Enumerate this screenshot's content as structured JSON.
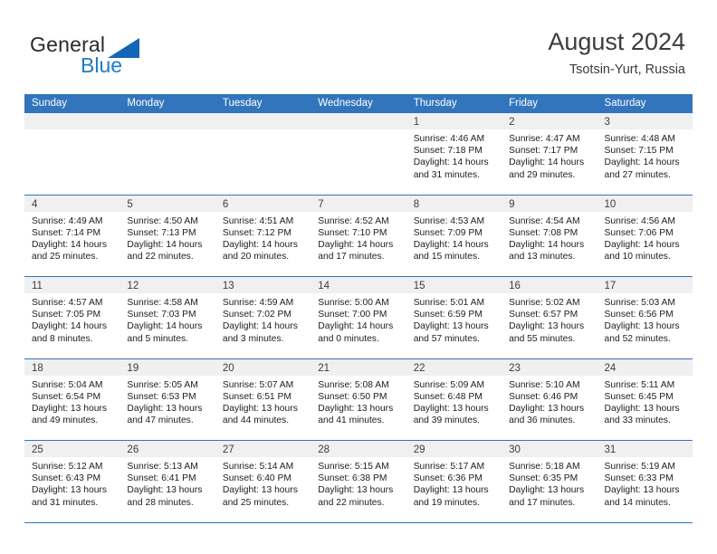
{
  "brand": {
    "name_top": "General",
    "name_bottom": "Blue",
    "triangle_color": "#1565b5",
    "blue_color": "#1f7cc4"
  },
  "header": {
    "title": "August 2024",
    "subtitle": "Tsotsin-Yurt, Russia"
  },
  "theme": {
    "header_blue": "#3275bd",
    "date_band": "#f0f0f0",
    "text": "#202020"
  },
  "calendar": {
    "weekdays": [
      "Sunday",
      "Monday",
      "Tuesday",
      "Wednesday",
      "Thursday",
      "Friday",
      "Saturday"
    ],
    "weeks": [
      [
        {
          "day": "",
          "empty": true
        },
        {
          "day": "",
          "empty": true
        },
        {
          "day": "",
          "empty": true
        },
        {
          "day": "",
          "empty": true
        },
        {
          "day": "1",
          "sunrise": "Sunrise: 4:46 AM",
          "sunset": "Sunset: 7:18 PM",
          "daylight1": "Daylight: 14 hours",
          "daylight2": "and 31 minutes."
        },
        {
          "day": "2",
          "sunrise": "Sunrise: 4:47 AM",
          "sunset": "Sunset: 7:17 PM",
          "daylight1": "Daylight: 14 hours",
          "daylight2": "and 29 minutes."
        },
        {
          "day": "3",
          "sunrise": "Sunrise: 4:48 AM",
          "sunset": "Sunset: 7:15 PM",
          "daylight1": "Daylight: 14 hours",
          "daylight2": "and 27 minutes."
        }
      ],
      [
        {
          "day": "4",
          "sunrise": "Sunrise: 4:49 AM",
          "sunset": "Sunset: 7:14 PM",
          "daylight1": "Daylight: 14 hours",
          "daylight2": "and 25 minutes."
        },
        {
          "day": "5",
          "sunrise": "Sunrise: 4:50 AM",
          "sunset": "Sunset: 7:13 PM",
          "daylight1": "Daylight: 14 hours",
          "daylight2": "and 22 minutes."
        },
        {
          "day": "6",
          "sunrise": "Sunrise: 4:51 AM",
          "sunset": "Sunset: 7:12 PM",
          "daylight1": "Daylight: 14 hours",
          "daylight2": "and 20 minutes."
        },
        {
          "day": "7",
          "sunrise": "Sunrise: 4:52 AM",
          "sunset": "Sunset: 7:10 PM",
          "daylight1": "Daylight: 14 hours",
          "daylight2": "and 17 minutes."
        },
        {
          "day": "8",
          "sunrise": "Sunrise: 4:53 AM",
          "sunset": "Sunset: 7:09 PM",
          "daylight1": "Daylight: 14 hours",
          "daylight2": "and 15 minutes."
        },
        {
          "day": "9",
          "sunrise": "Sunrise: 4:54 AM",
          "sunset": "Sunset: 7:08 PM",
          "daylight1": "Daylight: 14 hours",
          "daylight2": "and 13 minutes."
        },
        {
          "day": "10",
          "sunrise": "Sunrise: 4:56 AM",
          "sunset": "Sunset: 7:06 PM",
          "daylight1": "Daylight: 14 hours",
          "daylight2": "and 10 minutes."
        }
      ],
      [
        {
          "day": "11",
          "sunrise": "Sunrise: 4:57 AM",
          "sunset": "Sunset: 7:05 PM",
          "daylight1": "Daylight: 14 hours",
          "daylight2": "and 8 minutes."
        },
        {
          "day": "12",
          "sunrise": "Sunrise: 4:58 AM",
          "sunset": "Sunset: 7:03 PM",
          "daylight1": "Daylight: 14 hours",
          "daylight2": "and 5 minutes."
        },
        {
          "day": "13",
          "sunrise": "Sunrise: 4:59 AM",
          "sunset": "Sunset: 7:02 PM",
          "daylight1": "Daylight: 14 hours",
          "daylight2": "and 3 minutes."
        },
        {
          "day": "14",
          "sunrise": "Sunrise: 5:00 AM",
          "sunset": "Sunset: 7:00 PM",
          "daylight1": "Daylight: 14 hours",
          "daylight2": "and 0 minutes."
        },
        {
          "day": "15",
          "sunrise": "Sunrise: 5:01 AM",
          "sunset": "Sunset: 6:59 PM",
          "daylight1": "Daylight: 13 hours",
          "daylight2": "and 57 minutes."
        },
        {
          "day": "16",
          "sunrise": "Sunrise: 5:02 AM",
          "sunset": "Sunset: 6:57 PM",
          "daylight1": "Daylight: 13 hours",
          "daylight2": "and 55 minutes."
        },
        {
          "day": "17",
          "sunrise": "Sunrise: 5:03 AM",
          "sunset": "Sunset: 6:56 PM",
          "daylight1": "Daylight: 13 hours",
          "daylight2": "and 52 minutes."
        }
      ],
      [
        {
          "day": "18",
          "sunrise": "Sunrise: 5:04 AM",
          "sunset": "Sunset: 6:54 PM",
          "daylight1": "Daylight: 13 hours",
          "daylight2": "and 49 minutes."
        },
        {
          "day": "19",
          "sunrise": "Sunrise: 5:05 AM",
          "sunset": "Sunset: 6:53 PM",
          "daylight1": "Daylight: 13 hours",
          "daylight2": "and 47 minutes."
        },
        {
          "day": "20",
          "sunrise": "Sunrise: 5:07 AM",
          "sunset": "Sunset: 6:51 PM",
          "daylight1": "Daylight: 13 hours",
          "daylight2": "and 44 minutes."
        },
        {
          "day": "21",
          "sunrise": "Sunrise: 5:08 AM",
          "sunset": "Sunset: 6:50 PM",
          "daylight1": "Daylight: 13 hours",
          "daylight2": "and 41 minutes."
        },
        {
          "day": "22",
          "sunrise": "Sunrise: 5:09 AM",
          "sunset": "Sunset: 6:48 PM",
          "daylight1": "Daylight: 13 hours",
          "daylight2": "and 39 minutes."
        },
        {
          "day": "23",
          "sunrise": "Sunrise: 5:10 AM",
          "sunset": "Sunset: 6:46 PM",
          "daylight1": "Daylight: 13 hours",
          "daylight2": "and 36 minutes."
        },
        {
          "day": "24",
          "sunrise": "Sunrise: 5:11 AM",
          "sunset": "Sunset: 6:45 PM",
          "daylight1": "Daylight: 13 hours",
          "daylight2": "and 33 minutes."
        }
      ],
      [
        {
          "day": "25",
          "sunrise": "Sunrise: 5:12 AM",
          "sunset": "Sunset: 6:43 PM",
          "daylight1": "Daylight: 13 hours",
          "daylight2": "and 31 minutes."
        },
        {
          "day": "26",
          "sunrise": "Sunrise: 5:13 AM",
          "sunset": "Sunset: 6:41 PM",
          "daylight1": "Daylight: 13 hours",
          "daylight2": "and 28 minutes."
        },
        {
          "day": "27",
          "sunrise": "Sunrise: 5:14 AM",
          "sunset": "Sunset: 6:40 PM",
          "daylight1": "Daylight: 13 hours",
          "daylight2": "and 25 minutes."
        },
        {
          "day": "28",
          "sunrise": "Sunrise: 5:15 AM",
          "sunset": "Sunset: 6:38 PM",
          "daylight1": "Daylight: 13 hours",
          "daylight2": "and 22 minutes."
        },
        {
          "day": "29",
          "sunrise": "Sunrise: 5:17 AM",
          "sunset": "Sunset: 6:36 PM",
          "daylight1": "Daylight: 13 hours",
          "daylight2": "and 19 minutes."
        },
        {
          "day": "30",
          "sunrise": "Sunrise: 5:18 AM",
          "sunset": "Sunset: 6:35 PM",
          "daylight1": "Daylight: 13 hours",
          "daylight2": "and 17 minutes."
        },
        {
          "day": "31",
          "sunrise": "Sunrise: 5:19 AM",
          "sunset": "Sunset: 6:33 PM",
          "daylight1": "Daylight: 13 hours",
          "daylight2": "and 14 minutes."
        }
      ]
    ]
  }
}
